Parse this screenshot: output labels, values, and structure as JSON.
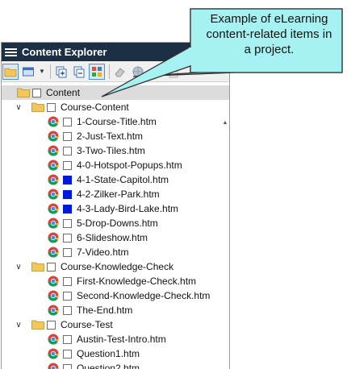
{
  "panel": {
    "title": "Content Explorer",
    "toolbar": [
      {
        "icon": "folder-icon",
        "active": true
      },
      {
        "icon": "view-icon"
      },
      {
        "icon": "add-file-icon"
      },
      {
        "icon": "remove-file-icon"
      },
      {
        "icon": "grid-view-icon",
        "active": true
      },
      {
        "icon": "eraser-icon",
        "disabled": true
      },
      {
        "icon": "globe-icon",
        "disabled": true
      },
      {
        "icon": "binder-icon",
        "disabled": true
      },
      {
        "icon": "page-icon",
        "disabled": true
      }
    ]
  },
  "callout": {
    "text_lines": [
      "Example of eLearning",
      "content-related items in",
      "a project."
    ],
    "fill": "#a6f2f2",
    "stroke": "#333333"
  },
  "tree": {
    "root": "Content",
    "folders": [
      {
        "name": "Course-Content",
        "files": [
          {
            "name": "1-Course-Title.htm",
            "marked": false
          },
          {
            "name": "2-Just-Text.htm",
            "marked": false
          },
          {
            "name": "3-Two-Tiles.htm",
            "marked": false
          },
          {
            "name": "4-0-Hotspot-Popups.htm",
            "marked": false
          },
          {
            "name": "4-1-State-Capitol.htm",
            "marked": true
          },
          {
            "name": "4-2-Zilker-Park.htm",
            "marked": true
          },
          {
            "name": "4-3-Lady-Bird-Lake.htm",
            "marked": true
          },
          {
            "name": "5-Drop-Downs.htm",
            "marked": false
          },
          {
            "name": "6-Slideshow.htm",
            "marked": false
          },
          {
            "name": "7-Video.htm",
            "marked": false
          }
        ]
      },
      {
        "name": "Course-Knowledge-Check",
        "files": [
          {
            "name": "First-Knowledge-Check.htm",
            "marked": false
          },
          {
            "name": "Second-Knowledge-Check.htm",
            "marked": false
          },
          {
            "name": "The-End.htm",
            "marked": false
          }
        ]
      },
      {
        "name": "Course-Test",
        "files": [
          {
            "name": "Austin-Test-Intro.htm",
            "marked": false
          },
          {
            "name": "Question1.htm",
            "marked": false
          },
          {
            "name": "Question2.htm",
            "marked": false
          }
        ]
      }
    ]
  },
  "colors": {
    "titlebar": "#1b2f45",
    "marked": "#0018d8"
  }
}
